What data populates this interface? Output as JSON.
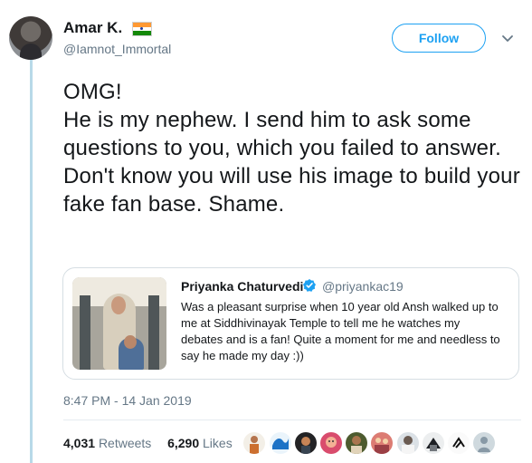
{
  "author": {
    "display_name": "Amar K.",
    "handle": "@Iamnot_Immortal"
  },
  "follow_button": {
    "label": "Follow"
  },
  "tweet": {
    "text": "OMG!\nHe is my nephew. I send him to ask some questions to you, which you failed to answer.\nDon't know you will use his image to build your fake fan base. Shame."
  },
  "quoted_tweet": {
    "name": "Priyanka Chaturvedi",
    "handle": "@priyankac19",
    "text": "Was a pleasant surprise when 10 year old Ansh walked up to me at Siddhivinayak Temple to tell me he watches my debates and is a fan! Quite a moment for me and needless to say he made my day :))"
  },
  "metadata": {
    "timestamp": "8:47 PM - 14 Jan 2019"
  },
  "stats": {
    "retweets_count": "4,031",
    "retweets_label": "Retweets",
    "likes_count": "6,290",
    "likes_label": "Likes"
  },
  "colors": {
    "accent": "#1da1f2",
    "muted": "#657786",
    "thread_line": "#b8d9e8"
  },
  "icons": [
    "flag-icon",
    "chevron-down-icon",
    "verified-icon"
  ]
}
